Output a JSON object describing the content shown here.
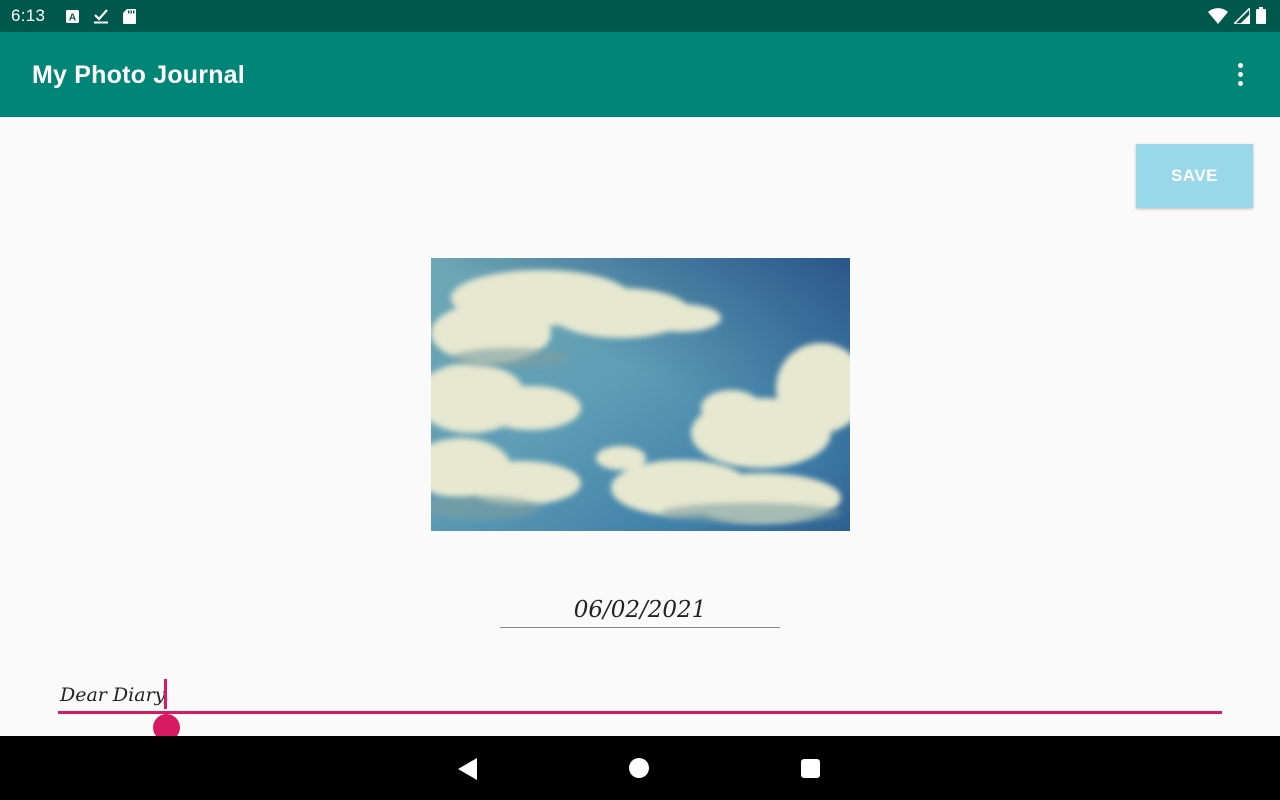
{
  "status_bar": {
    "time": "6:13",
    "left_icons": [
      "keyboard-a-icon",
      "download-done-icon",
      "sd-card-icon"
    ],
    "right_icons": [
      "wifi-icon",
      "cell-signal-icon",
      "battery-icon"
    ]
  },
  "app_bar": {
    "title": "My Photo Journal",
    "menu_icon": "more-vert-icon",
    "color": "#008577"
  },
  "toolbar": {
    "save_label": "SAVE"
  },
  "entry": {
    "photo_description": "sky-with-clouds",
    "date": "06/02/2021",
    "diary_text": "Dear Diary,"
  },
  "colors": {
    "status_bar": "#00574b",
    "accent": "#d81b60",
    "save_button": "#99d8ea"
  },
  "nav_bar": {
    "icons": [
      "back-icon",
      "home-icon",
      "recents-icon"
    ]
  }
}
